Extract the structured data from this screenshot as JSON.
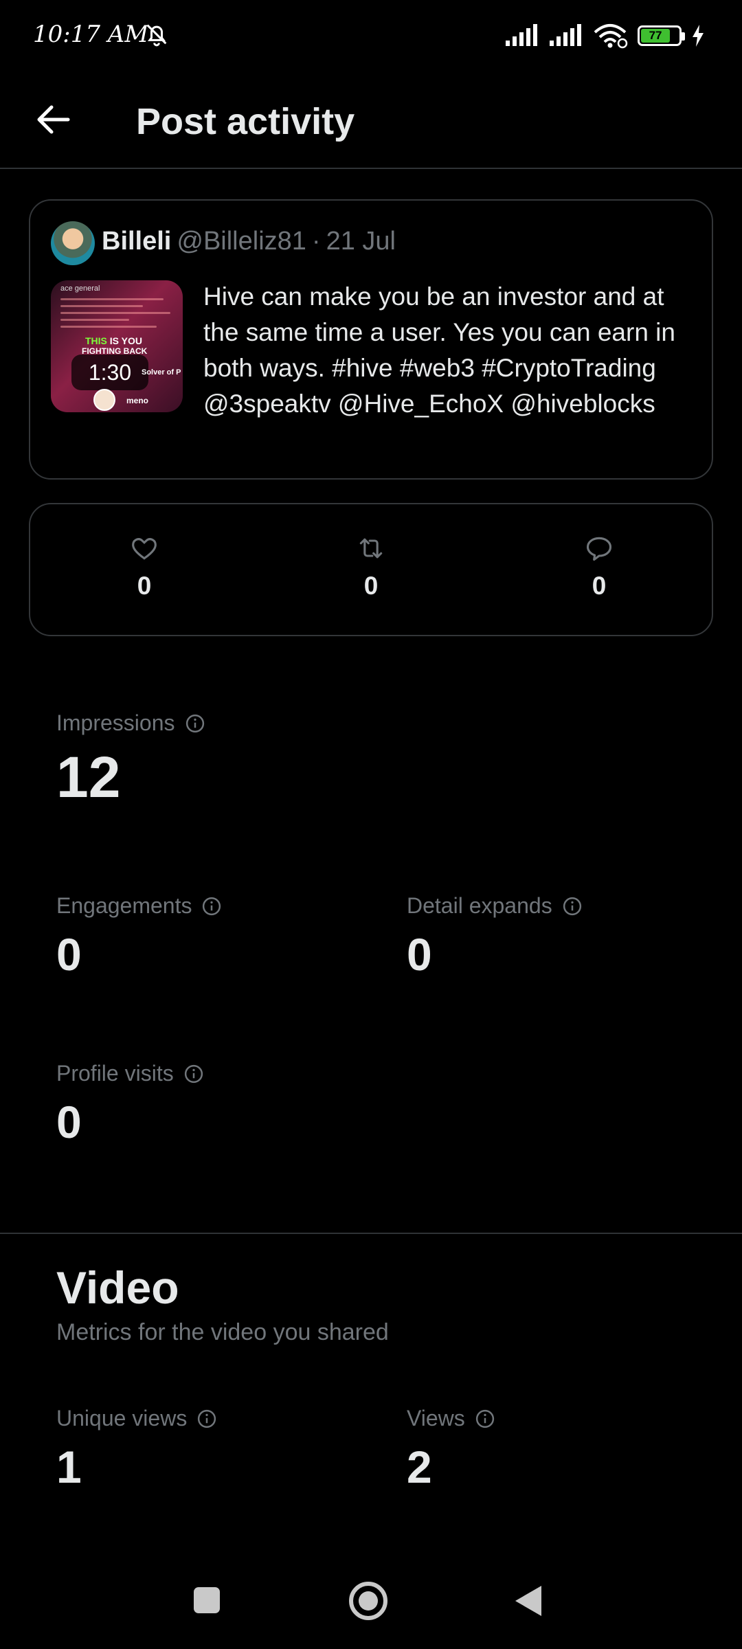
{
  "status_bar": {
    "time": "10:17 AM",
    "battery": "77",
    "icons": [
      "mute-bell-icon",
      "signal-icon",
      "signal-icon",
      "wifi-icon",
      "battery-icon",
      "charging-icon"
    ]
  },
  "header": {
    "title": "Post activity"
  },
  "post": {
    "author_name": "Billeli",
    "author_handle": "@Billeliz81",
    "date": "21 Jul",
    "video_duration": "1:30",
    "text": "Hive can make you be an investor and at the same time a user. Yes you can earn in both ways. #hive  #web3 #CryptoTrading  @3speaktv @Hive_EchoX  @hiveblocks",
    "thumbnail": {
      "top_text": "ace general",
      "headline_this": "THIS",
      "headline_rest": " IS YOU",
      "headline_line2": "FIGHTING BACK",
      "solver_text": "Solver of P",
      "footer_text": "meno"
    }
  },
  "engagement": {
    "likes": "0",
    "reposts": "0",
    "replies": "0"
  },
  "metrics": {
    "impressions_label": "Impressions",
    "impressions_value": "12",
    "engagements_label": "Engagements",
    "engagements_value": "0",
    "detail_expands_label": "Detail expands",
    "detail_expands_value": "0",
    "profile_visits_label": "Profile visits",
    "profile_visits_value": "0"
  },
  "video": {
    "title": "Video",
    "subtitle": "Metrics for the video you shared",
    "unique_views_label": "Unique views",
    "unique_views_value": "1",
    "views_label": "Views",
    "views_value": "2"
  },
  "colors": {
    "background": "#000000",
    "text_primary": "#e7e9ea",
    "text_secondary": "#71767b",
    "border": "#333639",
    "battery_fill": "#3fbf30"
  }
}
